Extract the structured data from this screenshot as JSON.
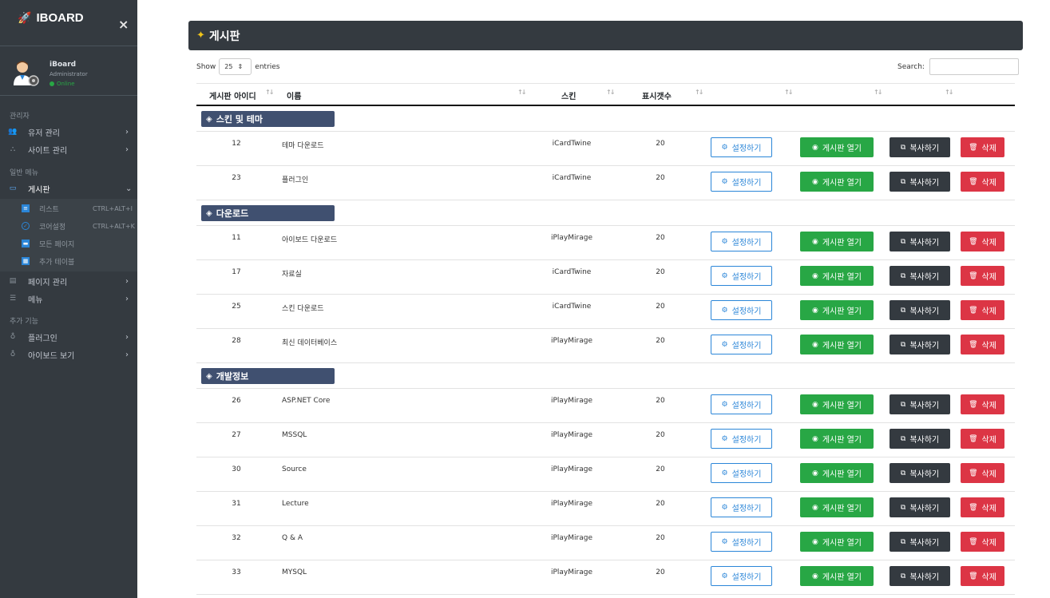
{
  "sidebar": {
    "brand": "IBOARD",
    "close": "×",
    "user": {
      "name": "iBoard",
      "role": "Administrator",
      "status": "Online"
    },
    "headers": [
      "관리자",
      "일반 메뉴",
      "추가 기능"
    ],
    "items": [
      {
        "label": "유저 관리",
        "icon": "users-icon"
      },
      {
        "label": "사이트 관리",
        "icon": "sitemap-icon"
      },
      {
        "label": "게시판",
        "icon": "board-icon"
      },
      {
        "label": "페이지 관리",
        "icon": "table-icon"
      },
      {
        "label": "메뉴",
        "icon": "list-icon"
      },
      {
        "label": "플러그인",
        "icon": "plug-icon"
      },
      {
        "label": "아이보드 보기",
        "icon": "eye-icon"
      }
    ],
    "subitems": [
      {
        "label": "리스트",
        "shortcut": "CTRL+ALT+I",
        "icon": "list-square-icon",
        "color": "#2b86d8"
      },
      {
        "label": "코어설정",
        "shortcut": "CTRL+ALT+K",
        "icon": "check-circle-icon",
        "color": "#2b86d8"
      },
      {
        "label": "모든 페이지",
        "shortcut": "",
        "icon": "pages-icon",
        "color": "#2b86d8"
      },
      {
        "label": "추가 테이블",
        "shortcut": "",
        "icon": "table-add-icon",
        "color": "#2b86d8"
      }
    ]
  },
  "header": {
    "title": "게시판"
  },
  "controls": {
    "show": "Show",
    "entries_value": "25",
    "entries": "entries",
    "search": "Search:"
  },
  "table": {
    "columns": [
      "게시판 아이디",
      "이름",
      "스킨",
      "표시갯수"
    ],
    "actions": {
      "setting": "설정하기",
      "open": "게시판 열기",
      "copy": "복사하기",
      "delete": "삭제"
    },
    "groups": [
      {
        "name": "스킨 및 테마",
        "rows": [
          {
            "id": "12",
            "name": "테마 다운로드",
            "skin": "iCardTwine",
            "count": "20"
          },
          {
            "id": "23",
            "name": "플러그인",
            "skin": "iCardTwine",
            "count": "20"
          }
        ]
      },
      {
        "name": "다운로드",
        "rows": [
          {
            "id": "11",
            "name": "아이보드 다운로드",
            "skin": "iPlayMirage",
            "count": "20"
          },
          {
            "id": "17",
            "name": "자료실",
            "skin": "iCardTwine",
            "count": "20"
          },
          {
            "id": "25",
            "name": "스킨 다운로드",
            "skin": "iCardTwine",
            "count": "20"
          },
          {
            "id": "28",
            "name": "최신 데이터베이스",
            "skin": "iPlayMirage",
            "count": "20"
          }
        ]
      },
      {
        "name": "개발정보",
        "rows": [
          {
            "id": "26",
            "name": "ASP.NET Core",
            "skin": "iPlayMirage",
            "count": "20"
          },
          {
            "id": "27",
            "name": "MSSQL",
            "skin": "iPlayMirage",
            "count": "20"
          },
          {
            "id": "30",
            "name": "Source",
            "skin": "iPlayMirage",
            "count": "20"
          },
          {
            "id": "31",
            "name": "Lecture",
            "skin": "iPlayMirage",
            "count": "20"
          },
          {
            "id": "32",
            "name": "Q & A",
            "skin": "iPlayMirage",
            "count": "20"
          },
          {
            "id": "33",
            "name": "MYSQL",
            "skin": "iPlayMirage",
            "count": "20"
          }
        ]
      }
    ]
  },
  "colors": {
    "sidebar": "#343a40",
    "group": "#405070",
    "setting": "#2b86d8",
    "open": "#28a745",
    "copy": "#343a40",
    "delete": "#dc3545"
  }
}
